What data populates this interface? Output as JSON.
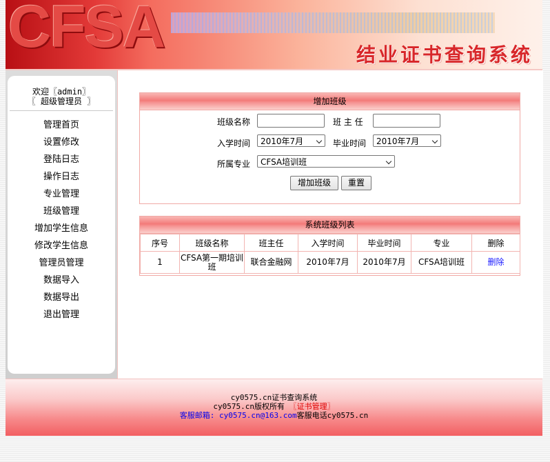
{
  "header": {
    "logo_text": "CFSA",
    "system_title": "结业证书查询系统"
  },
  "sidebar": {
    "welcome_line1": "欢迎〖admin〗",
    "welcome_line2": "〖 超级管理员 〗",
    "items": [
      {
        "label": "管理首页"
      },
      {
        "label": "设置修改"
      },
      {
        "label": "登陆日志"
      },
      {
        "label": "操作日志"
      },
      {
        "label": "专业管理"
      },
      {
        "label": "班级管理"
      },
      {
        "label": "增加学生信息"
      },
      {
        "label": "修改学生信息"
      },
      {
        "label": "管理员管理"
      },
      {
        "label": "数据导入"
      },
      {
        "label": "数据导出"
      },
      {
        "label": "退出管理"
      }
    ]
  },
  "add_form": {
    "title": "增加班级",
    "class_name_label": "班级名称",
    "class_name_value": "",
    "teacher_label": "班 主 任",
    "teacher_value": "",
    "start_label": "入学时间",
    "start_value": "2010年7月",
    "end_label": "毕业时间",
    "end_value": "2010年7月",
    "major_label": "所属专业",
    "major_value": "CFSA培训班",
    "submit_label": "增加班级",
    "reset_label": "重置"
  },
  "class_list": {
    "title": "系统班级列表",
    "columns": [
      "序号",
      "班级名称",
      "班主任",
      "入学时间",
      "毕业时间",
      "专业",
      "删除"
    ],
    "rows": [
      {
        "no": "1",
        "name": "CFSA第一期培训班",
        "teacher": "联合金融网",
        "start": "2010年7月",
        "end": "2010年7月",
        "major": "CFSA培训班",
        "delete": "删除"
      }
    ]
  },
  "footer": {
    "line1": "cy0575.cn证书查询系统",
    "line2_prefix": "cy0575.cn版权所有 ",
    "line2_highlight": "〖证书管理〗",
    "email_label": "客服邮箱:",
    "email_value": "cy0575.cn@163.com",
    "phone_label": "客服电话",
    "phone_value": "cy0575.cn"
  },
  "colors": {
    "accent_red": "#d8272a",
    "link_blue": "#1a1aff",
    "panel_border": "#f0a9a5"
  }
}
